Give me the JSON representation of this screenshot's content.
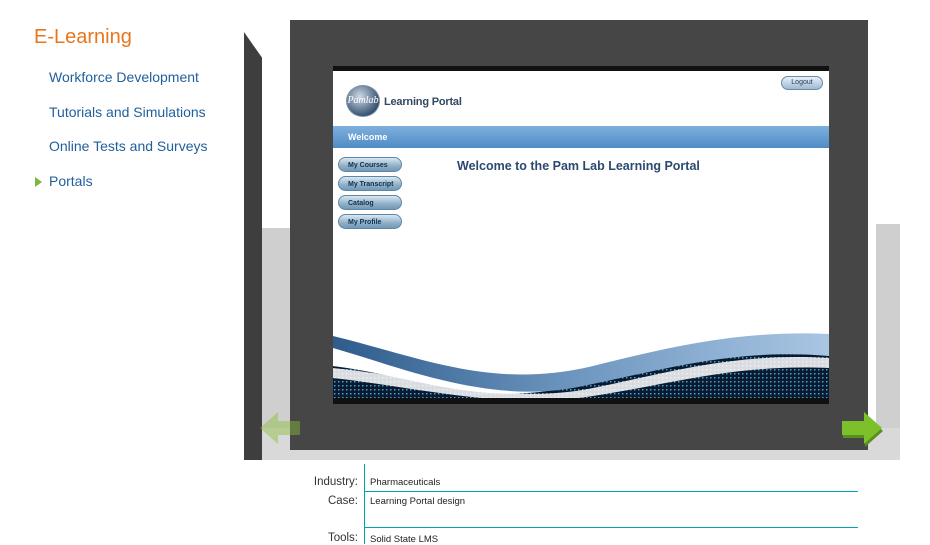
{
  "sidebar": {
    "title": "E-Learning",
    "items": [
      {
        "label": "Workforce Development"
      },
      {
        "label": "Tutorials and Simulations"
      },
      {
        "label": "Online Tests and Surveys"
      },
      {
        "label": "Portals",
        "active": true
      }
    ]
  },
  "portal": {
    "logout": "Logout",
    "logo_text": "Pamlab",
    "title": "Learning Portal",
    "welcome_bar": "Welcome",
    "heading": "Welcome to the Pam Lab Learning Portal",
    "menu": [
      "My Courses",
      "My Transcript",
      "Catalog",
      "My Profile"
    ]
  },
  "details": {
    "industry_label": "Industry:",
    "industry": "Pharmaceuticals",
    "case_label": "Case:",
    "case": "Learning Portal design",
    "tools_label": "Tools:",
    "tools": "Solid State LMS"
  },
  "colors": {
    "accent_orange": "#e8761c",
    "nav_blue": "#1f5f9c",
    "arrow_green": "#7cb83d",
    "rule_teal": "#00a3b4"
  },
  "icons": {
    "active_marker": "triangle-right-icon",
    "prev": "arrow-left-icon",
    "next": "arrow-right-icon"
  }
}
